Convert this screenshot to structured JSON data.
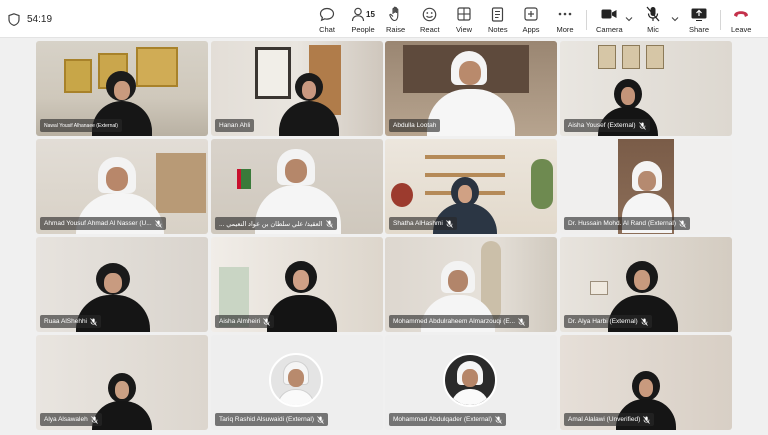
{
  "toolbar": {
    "timer": "54:19",
    "chat": "Chat",
    "people": "People",
    "people_count": "15",
    "raise": "Raise",
    "react": "React",
    "view": "View",
    "notes": "Notes",
    "apps": "Apps",
    "more": "More",
    "camera": "Camera",
    "mic": "Mic",
    "share": "Share",
    "leave": "Leave"
  },
  "colors": {
    "leave_red": "#c4314b",
    "toolbar_bg": "#ffffff",
    "grid_bg": "#f0f0f0"
  },
  "participants": [
    {
      "name": "Nawal Yousif Alhanaee (External)"
    },
    {
      "name": "Hanan Ahli"
    },
    {
      "name": "Abdulla Lootah"
    },
    {
      "name": "Aisha Yousef (External)"
    },
    {
      "name": "Ahmad Yousuf Ahmad Al Nasser (U..."
    },
    {
      "name": "العقيد/ علي سلطان بن عواد النعيمي ..."
    },
    {
      "name": "Shatha AlHashmi"
    },
    {
      "name": "Dr. Hussain Mohd. Al Rand (External)"
    },
    {
      "name": "Ruaa AlShehhi"
    },
    {
      "name": "Aisha Almheiri"
    },
    {
      "name": "Mohammed Abdulraheem Almarzouqi (E..."
    },
    {
      "name": "Dr. Alya Harbi (External)"
    },
    {
      "name": "Alya Alsawaleh"
    },
    {
      "name": "Tariq Rashid Alsuwaidi (External)"
    },
    {
      "name": "Mohammad Abdulqader (External)"
    },
    {
      "name": "Amal Alalawi (Unverified)"
    }
  ]
}
